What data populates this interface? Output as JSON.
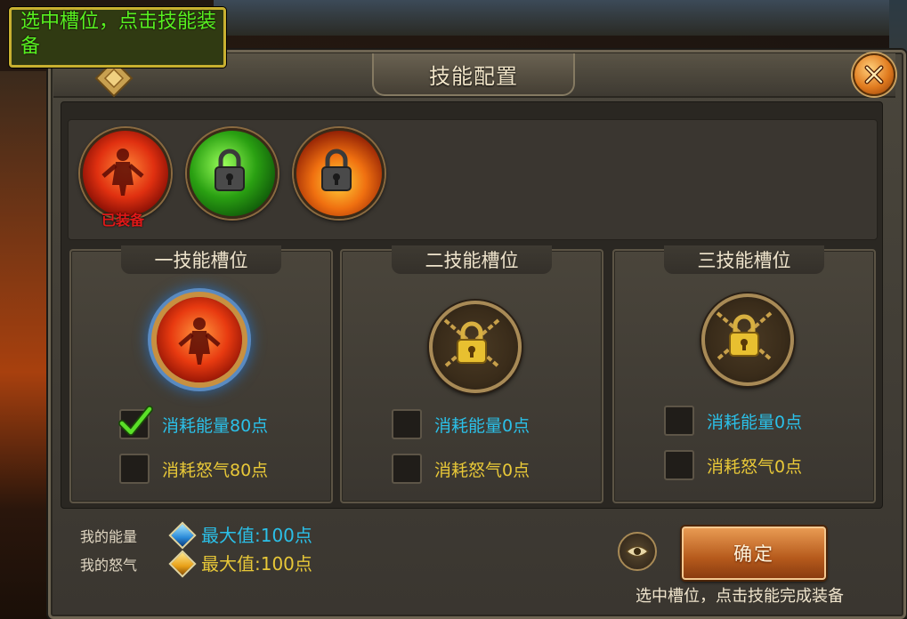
{
  "dialog": {
    "title": "技能配置"
  },
  "tooltip": {
    "text": "选中槽位，点击技能装备"
  },
  "skills": [
    {
      "name_icon": "red-fire-figure-skill",
      "status": "已装备",
      "locked": false,
      "equipped": true
    },
    {
      "name_icon": "green-wind-skill",
      "status": "",
      "locked": true,
      "equipped": false
    },
    {
      "name_icon": "flame-skill",
      "status": "",
      "locked": true,
      "equipped": false
    }
  ],
  "slots": [
    {
      "title": "一技能槽位",
      "locked": false,
      "energy_label": "消耗能量80点",
      "energy_checked": true,
      "rage_label": "消耗怒气80点",
      "rage_checked": false
    },
    {
      "title": "二技能槽位",
      "locked": true,
      "energy_label": "消耗能量0点",
      "energy_checked": false,
      "rage_label": "消耗怒气0点",
      "rage_checked": false
    },
    {
      "title": "三技能槽位",
      "locked": true,
      "energy_label": "消耗能量0点",
      "energy_checked": false,
      "rage_label": "消耗怒气0点",
      "rage_checked": false
    }
  ],
  "resources": {
    "energy_label": "我的能量",
    "energy_value": "最大值:100点",
    "rage_label": "我的怒气",
    "rage_value": "最大值:100点"
  },
  "buttons": {
    "confirm": "确定"
  },
  "footer_hint": "选中槽位，点击技能完成装备",
  "colors": {
    "energy": "#2bc0e8",
    "rage": "#e8c838",
    "equipped_text": "#e01818",
    "tooltip_text": "#58f020"
  }
}
